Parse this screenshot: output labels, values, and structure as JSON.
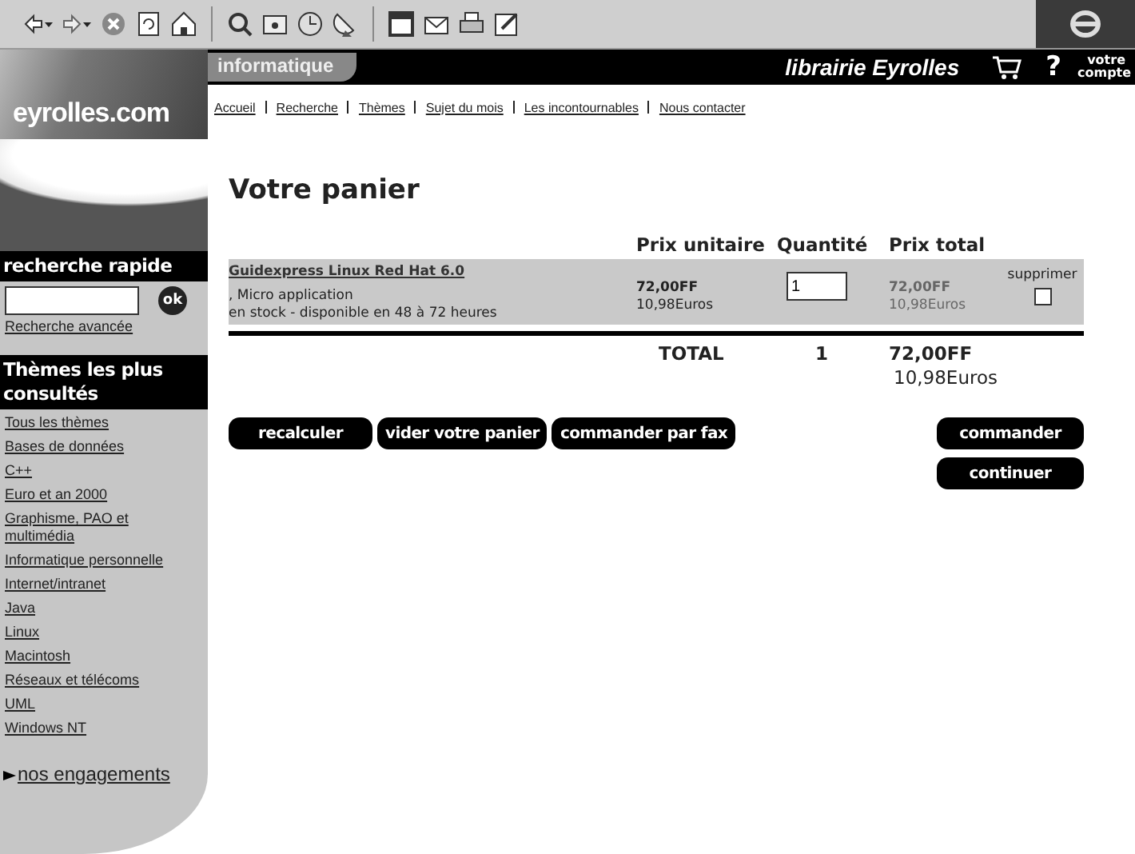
{
  "header": {
    "logo": "eyrolles.com",
    "section": "informatique",
    "brand": "librairie Eyrolles",
    "help": "?",
    "account": "votre compte"
  },
  "nav": [
    "Accueil",
    "Recherche",
    "Thèmes",
    "Sujet du mois",
    "Les incontournables",
    "Nous contacter"
  ],
  "sidebar": {
    "search_heading": "recherche rapide",
    "ok_button": "ok",
    "advanced_link": "Recherche avancée",
    "themes_heading": "Thèmes les plus consultés",
    "themes": [
      "Tous les thèmes",
      "Bases de données",
      "C++",
      "Euro et an 2000",
      "Graphisme, PAO et multimédia",
      "Informatique personnelle",
      "Internet/intranet",
      "Java",
      "Linux",
      "Macintosh",
      "Réseaux et télécoms",
      "UML",
      "Windows NT"
    ],
    "engagements_link": "nos engagements"
  },
  "page_title": "Votre panier",
  "table": {
    "columns": [
      "Prix unitaire",
      "Quantité",
      "Prix total"
    ],
    "rows": [
      {
        "title": "Guidexpress Linux Red Hat 6.0",
        "publisher": ", Micro application",
        "availability": "en stock - disponible en 48 à 72 heures",
        "unit_price_ff": "72,00FF",
        "unit_price_eur": "10,98Euros",
        "quantity": "1",
        "total_ff": "72,00FF",
        "total_eur": "10,98Euros",
        "remove_label": "supprimer",
        "remove_checked": false
      }
    ],
    "total": {
      "label": "TOTAL",
      "quantity": "1",
      "ff": "72,00FF",
      "eur": "10,98Euros"
    }
  },
  "buttons_left": [
    "recalculer",
    "vider votre panier",
    "commander par fax"
  ],
  "buttons_right": [
    "commander",
    "continuer"
  ]
}
